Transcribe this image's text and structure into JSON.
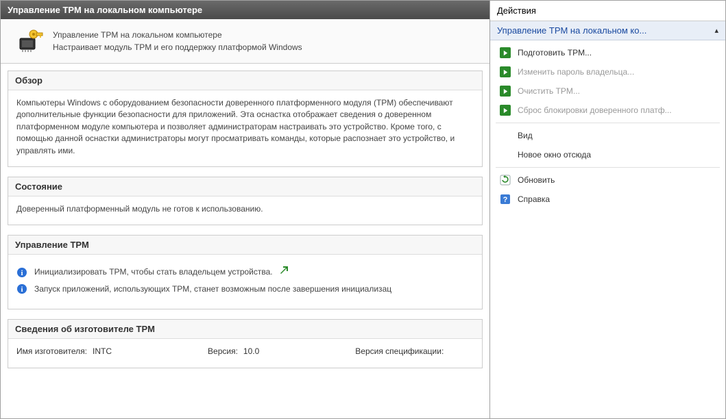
{
  "titlebar": {
    "text": "Управление TPM на локальном компьютере"
  },
  "header": {
    "line1": "Управление TPM на локальном компьютере",
    "line2": "Настраивает модуль TPM и его поддержку платформой Windows"
  },
  "overview": {
    "title": "Обзор",
    "text": "Компьютеры Windows с оборудованием безопасности доверенного платформенного модуля (TPM) обеспечивают дополнительные функции безопасности для приложений. Эта оснастка отображает сведения о доверенном платформенном модуле компьютера и позволяет администраторам настраивать это устройство. Кроме того, с помощью данной оснастки администраторы могут просматривать команды, которые распознает это устройство, и управлять ими."
  },
  "status": {
    "title": "Состояние",
    "text": "Доверенный платформенный модуль не готов к использованию."
  },
  "management": {
    "title": "Управление TPM",
    "line1": "Инициализировать TPM, чтобы стать владельцем устройства.",
    "line2": "Запуск приложений, использующих TPM, станет возможным после завершения инициализац"
  },
  "manufacturer": {
    "title": "Сведения об изготовителе TPM",
    "name_label": "Имя изготовителя:",
    "name_value": "INTC",
    "version_label": "Версия:",
    "version_value": "10.0",
    "spec_label": "Версия спецификации:"
  },
  "actions": {
    "title": "Действия",
    "subheader": "Управление TPM на локальном ко...",
    "items": {
      "prepare": "Подготовить TPM...",
      "change_password": "Изменить пароль владельца...",
      "clear": "Очистить TPM...",
      "reset_lockout": "Сброс блокировки доверенного платф...",
      "view": "Вид",
      "new_window": "Новое окно отсюда",
      "refresh": "Обновить",
      "help": "Справка"
    }
  }
}
